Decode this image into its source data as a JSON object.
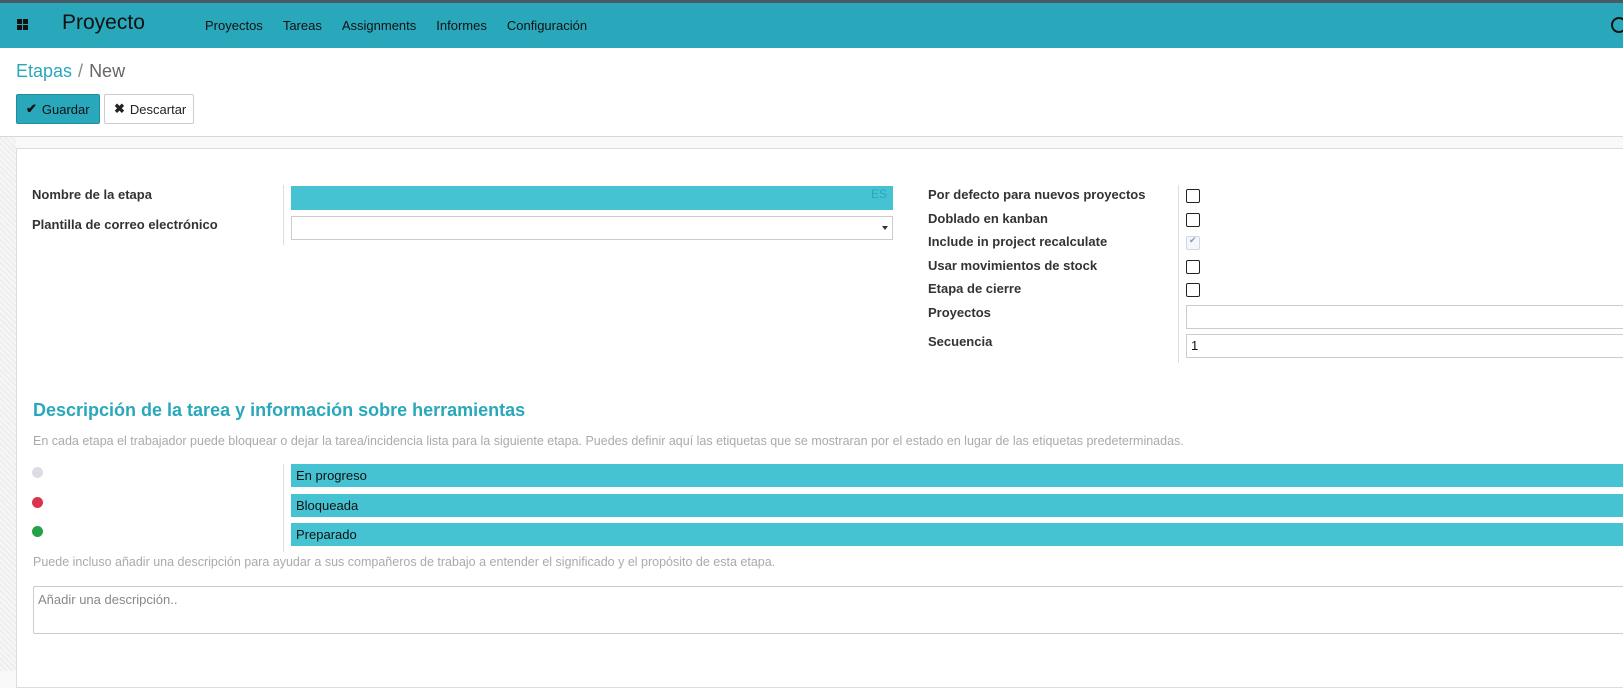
{
  "app": {
    "title": "Proyecto",
    "menu": [
      "Proyectos",
      "Tareas",
      "Assignments",
      "Informes",
      "Configuración"
    ]
  },
  "breadcrumb": {
    "parent": "Etapas",
    "current": "New"
  },
  "buttons": {
    "save": "Guardar",
    "discard": "Descartar"
  },
  "form": {
    "left": {
      "stage_name": {
        "label": "Nombre de la etapa",
        "value": "",
        "lang": "ES"
      },
      "mail_template": {
        "label": "Plantilla de correo electrónico",
        "value": ""
      }
    },
    "right": {
      "default_new_projects": {
        "label": "Por defecto para nuevos proyectos",
        "checked": false
      },
      "folded_kanban": {
        "label": "Doblado en kanban",
        "checked": false
      },
      "include_recalculate": {
        "label": "Include in project recalculate",
        "checked": true,
        "disabled": true
      },
      "use_stock_moves": {
        "label": "Usar movimientos de stock",
        "checked": false
      },
      "closing_stage": {
        "label": "Etapa de cierre",
        "checked": false
      },
      "projects": {
        "label": "Proyectos",
        "value": ""
      },
      "sequence": {
        "label": "Secuencia",
        "value": "1"
      }
    }
  },
  "tooltips_section": {
    "title": "Descripción de la tarea y información sobre herramientas",
    "help": "En cada etapa el trabajador puede bloquear o dejar la tarea/incidencia lista para la siguiente etapa. Puedes definir aquí las etiquetas que se mostraran por el estado en lugar de las etiquetas predeterminadas.",
    "states": [
      {
        "color": "#dcdde4",
        "label": "En progreso"
      },
      {
        "color": "#d9344c",
        "label": "Bloqueada"
      },
      {
        "color": "#23a347",
        "label": "Preparado"
      }
    ],
    "description_help": "Puede incluso añadir una descripción para ayudar a sus compañeros de trabajo a entender el significado y el propósito de esta etapa.",
    "description_placeholder": "Añadir una descripción.."
  }
}
